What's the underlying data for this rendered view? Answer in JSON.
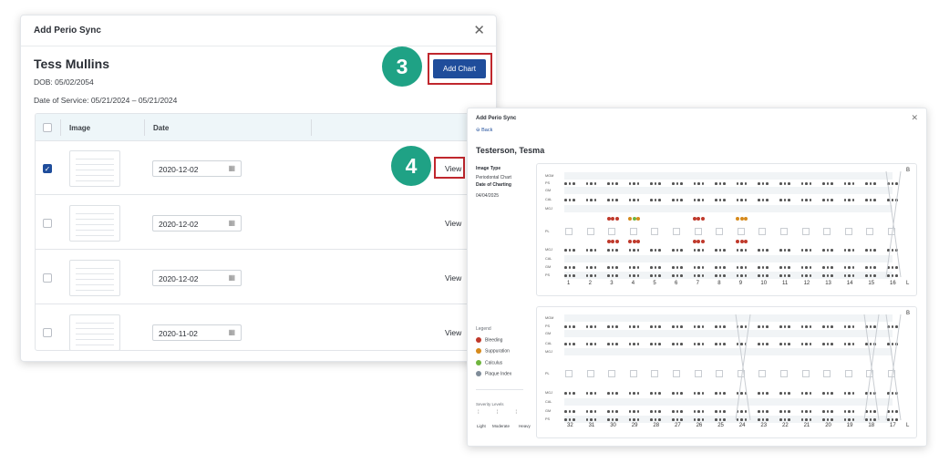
{
  "dialog1": {
    "title": "Add Perio Sync",
    "close_glyph": "✕",
    "patient_name": "Tess Mullins",
    "dob": "DOB: 05/02/2054",
    "date_of_service": "Date of Service: 05/21/2024 – 05/21/2024",
    "add_chart_label": "Add Chart",
    "columns": [
      "Image",
      "Date"
    ],
    "rows": [
      {
        "checked": true,
        "date": "2020-12-02",
        "action": "View"
      },
      {
        "checked": false,
        "date": "2020-12-02",
        "action": "View"
      },
      {
        "checked": false,
        "date": "2020-12-02",
        "action": "View"
      },
      {
        "checked": false,
        "date": "2020-11-02",
        "action": "View"
      }
    ]
  },
  "badges": {
    "step3": "3",
    "step4": "4"
  },
  "dialog2": {
    "title": "Add Perio Sync",
    "close_glyph": "✕",
    "back_label": "Back",
    "patient_name": "Testerson, Tesma",
    "image_type_label": "Image Type",
    "image_type_value": "Periodontal Chart",
    "date_label": "Date of Charting",
    "date_value": "04/04/2025",
    "legend_title": "Legend",
    "legend": [
      {
        "label": "Bleeding",
        "color": "#c0392b"
      },
      {
        "label": "Suppuration",
        "color": "#d68a1c"
      },
      {
        "label": "Calculus",
        "color": "#6fb53e"
      },
      {
        "label": "Plaque Index",
        "color": "#7f8c99"
      }
    ],
    "severity_title": "Severity Levels",
    "severity": [
      "Light",
      "Moderate",
      "Heavy"
    ],
    "upper_row_labels": [
      "MGM",
      "PS",
      "GM",
      "CAL",
      "MGJ",
      "PL",
      "MGJ",
      "CAL",
      "GM",
      "PS"
    ],
    "lower_row_labels": [
      "MGM",
      "PS",
      "GM",
      "CAL",
      "MGJ",
      "PL",
      "MGJ",
      "CAL",
      "GM",
      "PS"
    ],
    "upper_teeth": [
      "1",
      "2",
      "3",
      "4",
      "5",
      "6",
      "7",
      "8",
      "9",
      "10",
      "11",
      "12",
      "13",
      "14",
      "15",
      "16"
    ],
    "lower_teeth": [
      "32",
      "31",
      "30",
      "29",
      "28",
      "27",
      "26",
      "25",
      "24",
      "23",
      "22",
      "21",
      "20",
      "19",
      "18",
      "17"
    ],
    "side_top": "B",
    "side_bottom": "L"
  }
}
